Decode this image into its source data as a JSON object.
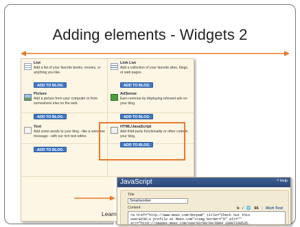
{
  "slide": {
    "title": "Adding elements - Widgets 2",
    "accent_color": "#e8792a",
    "learn_text": "Learn"
  },
  "gadgets": [
    {
      "icon": "list-icon",
      "title": "List",
      "description": "Add a list of your favorite books, movies, or anything you like.",
      "button": "ADD TO BLOG"
    },
    {
      "icon": "link-list-icon",
      "title": "Link List",
      "description": "Add a collection of your favorite sites, blogs, or web pages.",
      "button": "ADD TO BLOG"
    },
    {
      "icon": "picture-icon",
      "title": "Picture",
      "description": "Add a picture from your computer or from somewhere else on the web.",
      "button": "ADD TO BLOG"
    },
    {
      "icon": "adsense-icon",
      "title": "AdSense",
      "description": "Earn revenue by displaying relevant ads on your blog.",
      "button": "ADD TO BLOG"
    },
    {
      "icon": "text-icon",
      "title": "Text",
      "description": "Add some words to your blog - like a welcome message - with our rich text editor.",
      "button": "ADD TO BLOG"
    },
    {
      "icon": "html-javascript-icon",
      "title": "HTML/JavaScript",
      "description": "Add third-party functionality or other code to your blog.",
      "button": "ADD TO BLOG"
    }
  ],
  "dialog": {
    "title": "JavaScript",
    "help": "? Help",
    "title_label": "Title",
    "title_value": "Smartworker",
    "content_label": "Content",
    "toolbar": {
      "bold": "b",
      "italic": "i",
      "link": "🌐",
      "quote": "66",
      "rich_text": "Rich Text"
    },
    "content_value": "<a href=\"http://www.meez.com/docpam\" title=\"Check out this\nuser&#39;s profile at Meez.com\"><img border=\"0\" alt=\"\"\nsrc=\"http://images.meez.com/user03/09/04/0904_10007199535."
  }
}
